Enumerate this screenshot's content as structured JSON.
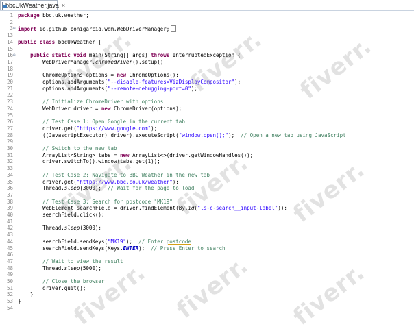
{
  "tab": {
    "title": "bbcUkWeather.java",
    "close": "×"
  },
  "watermark": "fiverr.",
  "lines": [
    {
      "n": "1",
      "segs": [
        {
          "t": "kw",
          "v": "package"
        },
        {
          "t": "p",
          "v": " bbc.uk.weather;"
        }
      ]
    },
    {
      "n": "2",
      "segs": []
    },
    {
      "n": "3",
      "fold": "⊕",
      "segs": [
        {
          "t": "kw",
          "v": "import"
        },
        {
          "t": "p",
          "v": " io.github.bonigarcia.wdm.WebDriverManager;"
        }
      ],
      "extra": "box"
    },
    {
      "n": "13",
      "segs": []
    },
    {
      "n": "14",
      "segs": [
        {
          "t": "kw",
          "v": "public"
        },
        {
          "t": "p",
          "v": " "
        },
        {
          "t": "kw",
          "v": "class"
        },
        {
          "t": "p",
          "v": " bbcUkWeather {"
        }
      ]
    },
    {
      "n": "15",
      "segs": []
    },
    {
      "n": "16",
      "fold": "⊖",
      "segs": [
        {
          "t": "p",
          "v": "    "
        },
        {
          "t": "kw",
          "v": "public"
        },
        {
          "t": "p",
          "v": " "
        },
        {
          "t": "kw",
          "v": "static"
        },
        {
          "t": "p",
          "v": " "
        },
        {
          "t": "kw",
          "v": "void"
        },
        {
          "t": "p",
          "v": " main(String[] args) "
        },
        {
          "t": "kw",
          "v": "throws"
        },
        {
          "t": "p",
          "v": " InterruptedException {"
        }
      ]
    },
    {
      "n": "17",
      "segs": [
        {
          "t": "p",
          "v": "        WebDriverManager."
        },
        {
          "t": "it",
          "v": "chromedriver"
        },
        {
          "t": "p",
          "v": "().setup();"
        }
      ]
    },
    {
      "n": "18",
      "segs": []
    },
    {
      "n": "19",
      "segs": [
        {
          "t": "p",
          "v": "        ChromeOptions options = "
        },
        {
          "t": "kw",
          "v": "new"
        },
        {
          "t": "p",
          "v": " ChromeOptions();"
        }
      ]
    },
    {
      "n": "20",
      "segs": [
        {
          "t": "p",
          "v": "        options.addArguments("
        },
        {
          "t": "st",
          "v": "\"--disable-features=VizDisplayCompositor\""
        },
        {
          "t": "p",
          "v": ");"
        }
      ]
    },
    {
      "n": "21",
      "segs": [
        {
          "t": "p",
          "v": "        options.addArguments("
        },
        {
          "t": "st",
          "v": "\"--remote-debugging-port=0\""
        },
        {
          "t": "p",
          "v": ");"
        }
      ]
    },
    {
      "n": "22",
      "segs": []
    },
    {
      "n": "23",
      "segs": [
        {
          "t": "cm",
          "v": "        // Initialize ChromeDriver with options"
        }
      ]
    },
    {
      "n": "24",
      "segs": [
        {
          "t": "p",
          "v": "        WebDriver driver = "
        },
        {
          "t": "kw",
          "v": "new"
        },
        {
          "t": "p",
          "v": " ChromeDriver(options);"
        }
      ]
    },
    {
      "n": "25",
      "segs": []
    },
    {
      "n": "26",
      "segs": [
        {
          "t": "cm",
          "v": "        // Test Case 1: Open Google in the current tab"
        }
      ]
    },
    {
      "n": "27",
      "segs": [
        {
          "t": "p",
          "v": "        driver.get("
        },
        {
          "t": "st",
          "v": "\"https://www.google.com\""
        },
        {
          "t": "p",
          "v": ");"
        }
      ]
    },
    {
      "n": "28",
      "segs": [
        {
          "t": "p",
          "v": "        ((JavascriptExecutor) driver).executeScript("
        },
        {
          "t": "st",
          "v": "\"window.open();\""
        },
        {
          "t": "p",
          "v": ");  "
        },
        {
          "t": "cm",
          "v": "// Open a new tab using JavaScript"
        }
      ]
    },
    {
      "n": "29",
      "segs": []
    },
    {
      "n": "30",
      "segs": [
        {
          "t": "cm",
          "v": "        // Switch to the new tab"
        }
      ]
    },
    {
      "n": "31",
      "segs": [
        {
          "t": "p",
          "v": "        ArrayList<String> tabs = "
        },
        {
          "t": "kw",
          "v": "new"
        },
        {
          "t": "p",
          "v": " ArrayList<>(driver.getWindowHandles());"
        }
      ]
    },
    {
      "n": "32",
      "segs": [
        {
          "t": "p",
          "v": "        driver.switchTo().window(tabs.get(1));"
        }
      ]
    },
    {
      "n": "33",
      "segs": []
    },
    {
      "n": "34",
      "segs": [
        {
          "t": "cm",
          "v": "        // Test Case 2: Navigate to BBC Weather in the new tab"
        }
      ]
    },
    {
      "n": "35",
      "segs": [
        {
          "t": "p",
          "v": "        driver.get("
        },
        {
          "t": "st",
          "v": "\"https://www.bbc.co.uk/weather\""
        },
        {
          "t": "p",
          "v": ");"
        }
      ]
    },
    {
      "n": "36",
      "segs": [
        {
          "t": "p",
          "v": "        Thread."
        },
        {
          "t": "it",
          "v": "sleep"
        },
        {
          "t": "p",
          "v": "(3000);  "
        },
        {
          "t": "cm",
          "v": "// Wait for the page to load"
        }
      ]
    },
    {
      "n": "37",
      "segs": []
    },
    {
      "n": "38",
      "segs": [
        {
          "t": "cm",
          "v": "        // Test Case 3: Search for postcode \"MK19\""
        }
      ]
    },
    {
      "n": "39",
      "segs": [
        {
          "t": "p",
          "v": "        WebElement searchField = driver.findElement(By."
        },
        {
          "t": "it",
          "v": "id"
        },
        {
          "t": "p",
          "v": "("
        },
        {
          "t": "st",
          "v": "\"ls-c-search__input-label\""
        },
        {
          "t": "p",
          "v": "));"
        }
      ]
    },
    {
      "n": "40",
      "segs": [
        {
          "t": "p",
          "v": "        searchField.click();"
        }
      ]
    },
    {
      "n": "41",
      "segs": []
    },
    {
      "n": "42",
      "segs": [
        {
          "t": "p",
          "v": "        Thread."
        },
        {
          "t": "it",
          "v": "sleep"
        },
        {
          "t": "p",
          "v": "(3000);"
        }
      ]
    },
    {
      "n": "43",
      "segs": []
    },
    {
      "n": "44",
      "segs": [
        {
          "t": "p",
          "v": "        searchField.sendKeys("
        },
        {
          "t": "st",
          "v": "\"MK19\""
        },
        {
          "t": "p",
          "v": ");  "
        },
        {
          "t": "cm",
          "v": "// Enter "
        },
        {
          "t": "cmu",
          "v": "postcode"
        }
      ]
    },
    {
      "n": "45",
      "segs": [
        {
          "t": "p",
          "v": "        searchField.sendKeys(Keys."
        },
        {
          "t": "bi",
          "v": "ENTER"
        },
        {
          "t": "p",
          "v": ");  "
        },
        {
          "t": "cm",
          "v": "// Press Enter to search"
        }
      ]
    },
    {
      "n": "46",
      "segs": []
    },
    {
      "n": "47",
      "segs": [
        {
          "t": "cm",
          "v": "        // Wait to view the result"
        }
      ]
    },
    {
      "n": "48",
      "segs": [
        {
          "t": "p",
          "v": "        Thread."
        },
        {
          "t": "it",
          "v": "sleep"
        },
        {
          "t": "p",
          "v": "(5000);"
        }
      ]
    },
    {
      "n": "49",
      "segs": []
    },
    {
      "n": "50",
      "segs": [
        {
          "t": "cm",
          "v": "        // Close the browser"
        }
      ]
    },
    {
      "n": "51",
      "segs": [
        {
          "t": "p",
          "v": "        driver.quit();"
        }
      ]
    },
    {
      "n": "52",
      "segs": [
        {
          "t": "p",
          "v": "    }"
        }
      ]
    },
    {
      "n": "53",
      "segs": [
        {
          "t": "p",
          "v": "}"
        }
      ]
    },
    {
      "n": "54",
      "segs": []
    }
  ]
}
